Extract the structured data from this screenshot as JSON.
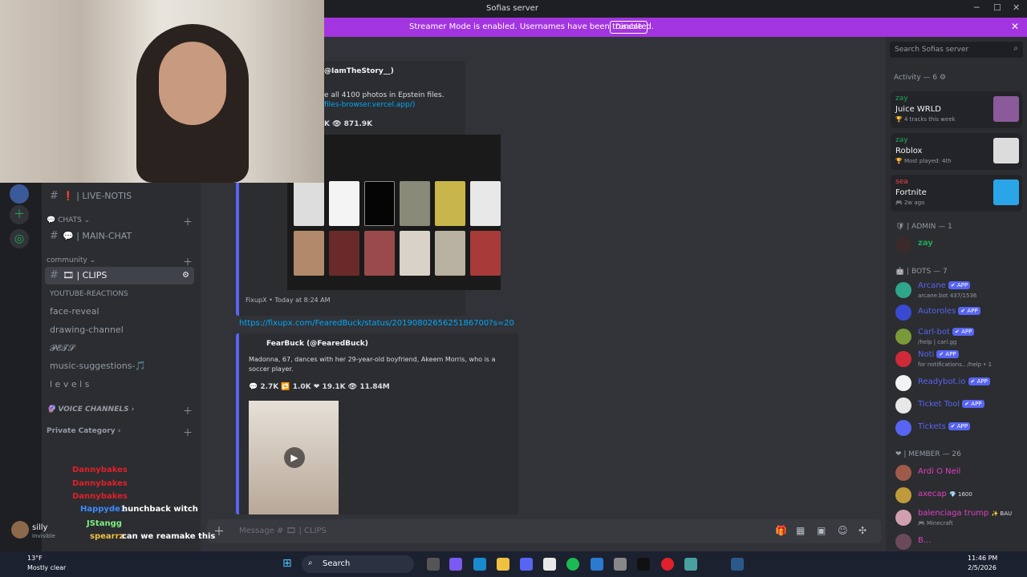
{
  "window": {
    "title": "Sofias server",
    "min": "─",
    "max": "☐",
    "close": "✕"
  },
  "banner": {
    "message": "Streamer Mode is enabled. Usernames have been truncated.",
    "disable_label": "Disable",
    "close": "✕"
  },
  "channels": {
    "live_notis": "❗ | LIVE-NOTIS",
    "chats_category": "💬 CHATS ⌄",
    "main_chat": "💬 | MAIN-CHAT",
    "community_category": "community ⌄",
    "clips": "🎞 | CLIPS",
    "youtube_reactions": "YOUTUBE-REACTIONS",
    "face_reveal": "face-reveal",
    "drawing_channel": "drawing-channel",
    "pets": "𝓟𝓔𝓣𝓢",
    "music_suggestions": "music-suggestions-🎵",
    "levels": "l e v e l s",
    "voice_category": "🔮 VOICE CHANNELS ›",
    "private_category": "Private Category ›"
  },
  "chat": {
    "embed1": {
      "author": "@IamTheStory__)",
      "text": "e all 4100 photos in Epstein files.",
      "link": "files-browser.vercel.app/)",
      "stats": "K  👁 871.9K",
      "footer": "FixupX • Today at 8:24 AM"
    },
    "link2": "https://fixupx.com/FearedBuck/status/2019080265625186700?s=20",
    "embed2": {
      "author": "FearBuck (@FearedBuck)",
      "text1": "Madonna, 67, dances with her 29-year-old boyfriend, Akeem Morris, who is a",
      "text2": "soccer player.",
      "stats": "💬 2.7K  🔁 1.0K  ❤ 19.1K  👁 11.84M"
    },
    "composer_placeholder": "Message # 🎞 | CLIPS"
  },
  "members": {
    "search_placeholder": "Search Sofias server",
    "activity_header": "Activity — 6 ⚙",
    "activities": [
      {
        "user": "zay",
        "title": "Juice WRLD",
        "sub": "🏆 4 tracks this week"
      },
      {
        "user": "zay",
        "title": "Roblox",
        "sub": "🏆 Most played: 4th"
      },
      {
        "user": "sea",
        "title": "Fortnite",
        "sub": "🎮 2w ago"
      }
    ],
    "admin_header": "🛡 | ADMIN — 1",
    "admin": "zay",
    "bots_header": "🤖 | BOTS — 7",
    "bots": [
      {
        "name": "Arcane",
        "sub": "arcane.bot 437/1536"
      },
      {
        "name": "Autoroles",
        "sub": ""
      },
      {
        "name": "Carl-bot",
        "sub": "/help | carl.gg"
      },
      {
        "name": "Noti",
        "sub": "for notifications.. /help • 1"
      },
      {
        "name": "Readybot.io",
        "sub": ""
      },
      {
        "name": "Ticket Tool",
        "sub": ""
      },
      {
        "name": "Tickets",
        "sub": ""
      }
    ],
    "app_badge": "✔ APP",
    "member_header": "❤ | MEMBER — 26",
    "members_list": [
      {
        "name": "Ardi O Neil",
        "sub": ""
      },
      {
        "name": "axecap",
        "sub": "",
        "badge": "💎 1600"
      },
      {
        "name": "balenciaga trump",
        "sub": "🎮 Minecraft",
        "badge": "✨ BAU"
      },
      {
        "name": "B...",
        "sub": ""
      }
    ]
  },
  "user_panel": {
    "name": "silly",
    "status": "Invisible"
  },
  "overlay_chat": [
    {
      "user": "Dannybakes",
      "msg": ""
    },
    {
      "user": "Dannybakes",
      "msg": ""
    },
    {
      "user": "Dannybakes",
      "msg": ""
    },
    {
      "user": "Happyde1",
      "msg": "hunchback witch"
    },
    {
      "user": "JStangg",
      "msg": ""
    },
    {
      "user": "spearrz",
      "msg": "can we reamake this"
    }
  ],
  "taskbar": {
    "weather_temp": "13°F",
    "weather_desc": "Mostly clear",
    "search_label": "Search",
    "time": "11:46 PM",
    "date": "2/5/2026"
  },
  "colors": {
    "accent": "#5865f2",
    "banner": "#a335e0",
    "online": "#23a55a",
    "link": "#00a8fc"
  }
}
